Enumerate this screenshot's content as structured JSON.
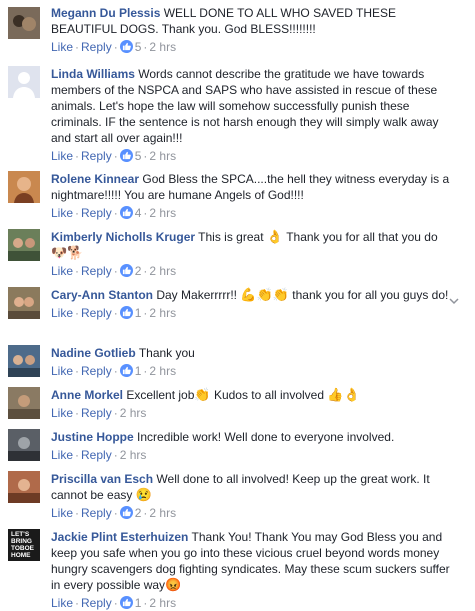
{
  "actions": {
    "like": "Like",
    "reply": "Reply",
    "dot": "·"
  },
  "comments": [
    {
      "name": "Megann Du Plessis",
      "text": "WELL DONE TO ALL WHO SAVED THESE BEAUTIFUL DOGS. Thank you. God BLESS!!!!!!!!",
      "likes": "5",
      "time": "2 hrs",
      "avatar_color": "#7a6a5a"
    },
    {
      "name": "Linda Williams",
      "text": "Words cannot describe the gratitude we have towards members of the NSPCA and SAPS who have assisted in rescue of these animals. Let's hope the law will somehow successfully punish these criminals. IF the sentence is not harsh enough they will simply walk away and start all over again!!!",
      "likes": "5",
      "time": "2 hrs",
      "avatar_color": "#e9ebee"
    },
    {
      "name": "Rolene Kinnear",
      "text": "God Bless the SPCA....the hell they witness everyday is a nightmare!!!!! You are humane Angels of God!!!!",
      "likes": "4",
      "time": "2 hrs",
      "avatar_color": "#c9884f"
    },
    {
      "name": "Kimberly Nicholls Kruger",
      "text": "This is great",
      "text2": "Thank you for all that you do",
      "likes": "2",
      "time": "2 hrs",
      "avatar_color": "#6b7f5a",
      "emoji1": "👌",
      "emoji_line": "🐶🐕"
    },
    {
      "name": "Cary-Ann Stanton",
      "text": "Day Makerrrrr!!",
      "text2": "thank you for all you guys do!",
      "likes": "1",
      "time": "2 hrs",
      "avatar_color": "#8b7a5d",
      "emoji1": "💪👏👏"
    },
    {
      "name": "Nadine Gotlieb",
      "text": "Thank you",
      "likes": "1",
      "time": "2 hrs",
      "avatar_color": "#4d6b8a"
    },
    {
      "name": "Anne Morkel",
      "text": "Excellent job",
      "text2": "Kudos to all involved",
      "time": "2 hrs",
      "avatar_color": "#8a7a63",
      "emoji1": "👏",
      "emoji2": "👍👌"
    },
    {
      "name": "Justine Hoppe",
      "text": "Incredible work! Well done to everyone involved.",
      "time": "2 hrs",
      "avatar_color": "#5a5f66"
    },
    {
      "name": "Priscilla van Esch",
      "text": "Well done to all involved! Keep up the great work. It cannot be easy",
      "likes": "2",
      "time": "2 hrs",
      "avatar_color": "#b06a4a",
      "emoji1": "😢"
    },
    {
      "name": "Jackie Plint Esterhuizen",
      "text": "Thank You! Thank You may God Bless you and keep you safe when you go into these vicious cruel beyond words money hungry scavengers dog fighting syndicates. May these scum suckers suffer in every possible way",
      "likes": "1",
      "time": "2 hrs",
      "avatar_color": "#1a1a1a",
      "avatar_text": "LET'S BRING TOBOE HOME",
      "emoji1": "😡"
    }
  ]
}
